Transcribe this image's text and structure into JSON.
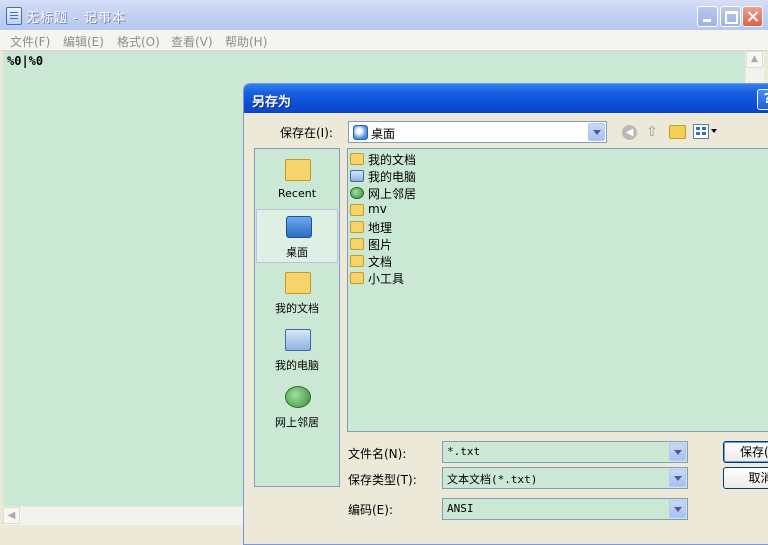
{
  "notepad": {
    "title": "无标题 - 记事本",
    "menu": [
      "文件(F)",
      "编辑(E)",
      "格式(O)",
      "查看(V)",
      "帮助(H)"
    ],
    "content": "%0|%0",
    "scroll_up": "▲",
    "scroll_left": "◀"
  },
  "dialog": {
    "title": "另存为",
    "help": "?",
    "save_in_label": "保存在(I):",
    "save_in_value": "桌面",
    "nav_back": "◀",
    "nav_up": "⇧",
    "places": [
      {
        "label": "Recent",
        "icon": "folder-recent-icon"
      },
      {
        "label": "桌面",
        "icon": "desktop-icon",
        "selected": true
      },
      {
        "label": "我的文档",
        "icon": "my-documents-icon"
      },
      {
        "label": "我的电脑",
        "icon": "my-computer-icon"
      },
      {
        "label": "网上邻居",
        "icon": "network-places-icon"
      }
    ],
    "files": [
      {
        "label": "我的文档",
        "icon": "my-documents-icon"
      },
      {
        "label": "我的电脑",
        "icon": "my-computer-icon"
      },
      {
        "label": "网上邻居",
        "icon": "network-places-icon"
      },
      {
        "label": "mv",
        "icon": "folder-icon"
      },
      {
        "label": "地理",
        "icon": "folder-icon"
      },
      {
        "label": "图片",
        "icon": "folder-icon"
      },
      {
        "label": "文档",
        "icon": "folder-icon"
      },
      {
        "label": "小工具",
        "icon": "folder-icon"
      }
    ],
    "filename_label": "文件名(N):",
    "filename_value": "*.txt",
    "filetype_label": "保存类型(T):",
    "filetype_value": "文本文档(*.txt)",
    "encoding_label": "编码(E):",
    "encoding_value": "ANSI",
    "save_button": "保存(S)",
    "cancel_button": "取消"
  },
  "colors": {
    "editor_bg": "#cae8d3",
    "dialog_title_bg": "#0a4ed5"
  }
}
